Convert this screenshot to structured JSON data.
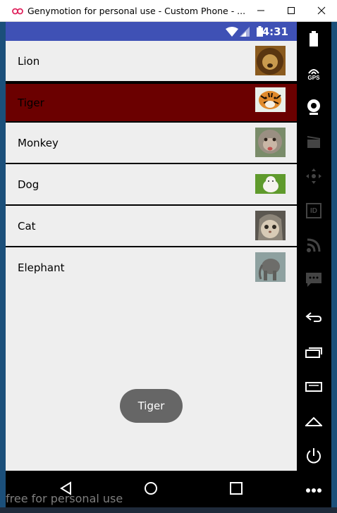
{
  "window": {
    "title": "Genymotion for personal use - Custom Phone - ...",
    "icons": [
      "genymotion-logo-icon",
      "minimize-icon",
      "maximize-icon",
      "close-icon"
    ]
  },
  "statusbar": {
    "time": "4:31",
    "icons": [
      "wifi-icon",
      "signal-icon",
      "battery-icon"
    ]
  },
  "list": {
    "items": [
      {
        "label": "Lion",
        "thumb_icon": "lion-photo",
        "selected": false
      },
      {
        "label": "Tiger",
        "thumb_icon": "tiger-photo",
        "selected": true
      },
      {
        "label": "Monkey",
        "thumb_icon": "monkey-photo",
        "selected": false
      },
      {
        "label": "Dog",
        "thumb_icon": "dog-photo",
        "selected": false
      },
      {
        "label": "Cat",
        "thumb_icon": "cat-photo",
        "selected": false
      },
      {
        "label": "Elephant",
        "thumb_icon": "elephant-photo",
        "selected": false
      }
    ],
    "selected_color": "#6b0000"
  },
  "toast": {
    "text": "Tiger"
  },
  "navbar": {
    "icons": [
      "back-icon",
      "home-icon",
      "recents-icon"
    ]
  },
  "sidebar": {
    "gps_label": "GPS",
    "id_label": "ID",
    "icons": [
      "battery-icon",
      "gps-icon",
      "webcam-icon",
      "video-icon",
      "move-icon",
      "id-icon",
      "rss-icon",
      "sms-icon",
      "back-icon",
      "recent-apps-icon",
      "menu-icon",
      "home-icon",
      "power-icon",
      "more-icon"
    ]
  },
  "watermark": {
    "text": "free for personal use"
  },
  "colors": {
    "statusbar": "#3f51b5",
    "screen_bg": "#eeeeee",
    "toast_bg": "#666666"
  }
}
